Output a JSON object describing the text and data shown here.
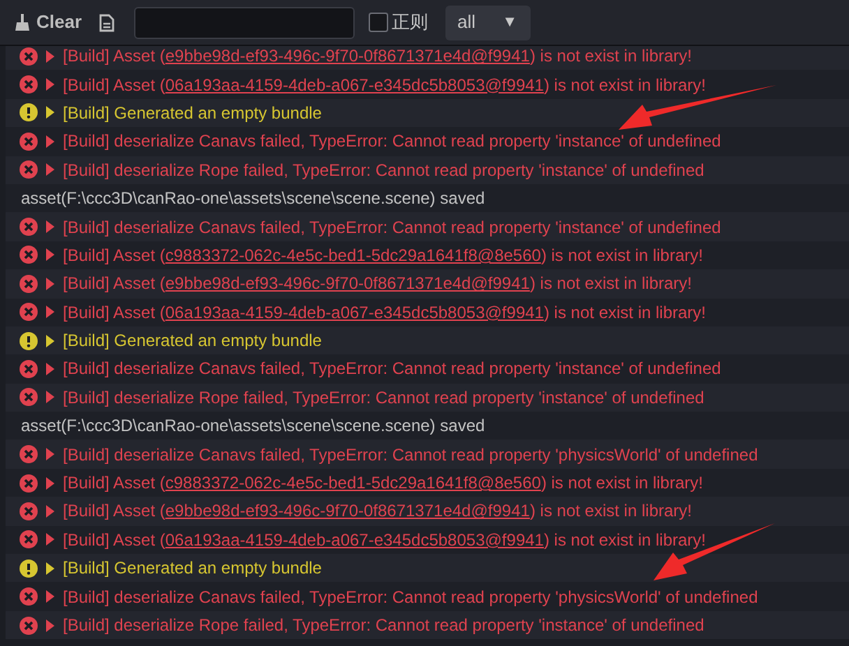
{
  "toolbar": {
    "clear_label": "Clear",
    "regex": {
      "label": "正则",
      "checked": false
    },
    "level_filter": {
      "value": "all",
      "caret": "▼"
    }
  },
  "log": [
    {
      "kind": "error",
      "prefix": "[Build] Asset (",
      "link": "e9bbe98d-ef93-496c-9f70-0f8671371e4d@f9941",
      "suffix": ") is not exist in library!"
    },
    {
      "kind": "error",
      "prefix": "[Build] Asset (",
      "link": "06a193aa-4159-4deb-a067-e345dc5b8053@f9941",
      "suffix": ") is not exist in library!"
    },
    {
      "kind": "warning",
      "prefix": "[Build] Generated an empty bundle"
    },
    {
      "kind": "error",
      "prefix": "[Build] deserialize Canavs failed, TypeError: Cannot read property 'instance' of undefined"
    },
    {
      "kind": "error",
      "prefix": "[Build] deserialize Rope failed, TypeError: Cannot read property 'instance' of undefined"
    },
    {
      "kind": "info",
      "prefix": "asset(F:\\ccc3D\\canRao-one\\assets\\scene\\scene.scene) saved"
    },
    {
      "kind": "error",
      "prefix": "[Build] deserialize Canavs failed, TypeError: Cannot read property 'instance' of undefined"
    },
    {
      "kind": "error",
      "prefix": "[Build] Asset (",
      "link": "c9883372-062c-4e5c-bed1-5dc29a1641f8@8e560",
      "suffix": ") is not exist in library!"
    },
    {
      "kind": "error",
      "prefix": "[Build] Asset (",
      "link": "e9bbe98d-ef93-496c-9f70-0f8671371e4d@f9941",
      "suffix": ") is not exist in library!"
    },
    {
      "kind": "error",
      "prefix": "[Build] Asset (",
      "link": "06a193aa-4159-4deb-a067-e345dc5b8053@f9941",
      "suffix": ") is not exist in library!"
    },
    {
      "kind": "warning",
      "prefix": "[Build] Generated an empty bundle"
    },
    {
      "kind": "error",
      "prefix": "[Build] deserialize Canavs failed, TypeError: Cannot read property 'instance' of undefined"
    },
    {
      "kind": "error",
      "prefix": "[Build] deserialize Rope failed, TypeError: Cannot read property 'instance' of undefined"
    },
    {
      "kind": "info",
      "prefix": "asset(F:\\ccc3D\\canRao-one\\assets\\scene\\scene.scene) saved"
    },
    {
      "kind": "error",
      "prefix": "[Build] deserialize Canavs failed, TypeError: Cannot read property 'physicsWorld' of undefined"
    },
    {
      "kind": "error",
      "prefix": "[Build] Asset (",
      "link": "c9883372-062c-4e5c-bed1-5dc29a1641f8@8e560",
      "suffix": ") is not exist in library!"
    },
    {
      "kind": "error",
      "prefix": "[Build] Asset (",
      "link": "e9bbe98d-ef93-496c-9f70-0f8671371e4d@f9941",
      "suffix": ") is not exist in library!"
    },
    {
      "kind": "error",
      "prefix": "[Build] Asset (",
      "link": "06a193aa-4159-4deb-a067-e345dc5b8053@f9941",
      "suffix": ") is not exist in library!"
    },
    {
      "kind": "warning",
      "prefix": "[Build] Generated an empty bundle"
    },
    {
      "kind": "error",
      "prefix": "[Build] deserialize Canavs failed, TypeError: Cannot read property 'physicsWorld' of undefined"
    },
    {
      "kind": "error",
      "prefix": "[Build] deserialize Rope failed, TypeError: Cannot read property 'instance' of undefined"
    }
  ]
}
